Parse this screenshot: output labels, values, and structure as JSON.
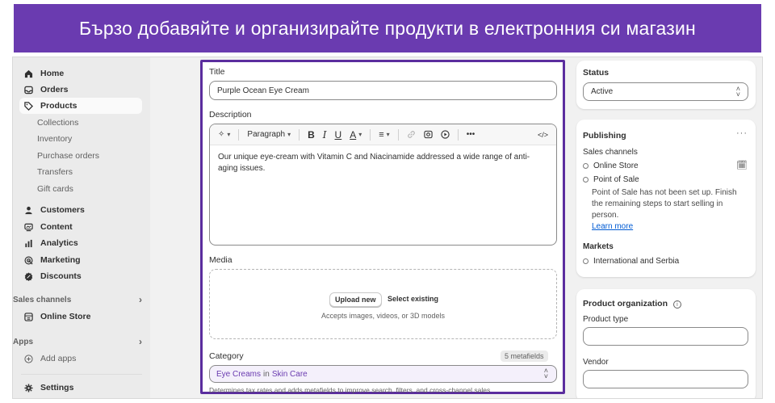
{
  "banner": {
    "text": "Бързо добавяйте и организирайте продукти в електронния си магазин"
  },
  "sidebar": {
    "items": [
      {
        "label": "Home",
        "icon": "home-icon"
      },
      {
        "label": "Orders",
        "icon": "inbox-icon"
      },
      {
        "label": "Products",
        "icon": "tag-icon"
      }
    ],
    "products_sub": [
      "Collections",
      "Inventory",
      "Purchase orders",
      "Transfers",
      "Gift cards"
    ],
    "items2": [
      {
        "label": "Customers",
        "icon": "person-icon"
      },
      {
        "label": "Content",
        "icon": "content-icon"
      },
      {
        "label": "Analytics",
        "icon": "bar-chart-icon"
      },
      {
        "label": "Marketing",
        "icon": "target-icon"
      },
      {
        "label": "Discounts",
        "icon": "discount-icon"
      }
    ],
    "sales_channels_label": "Sales channels",
    "online_store": "Online Store",
    "apps_label": "Apps",
    "add_apps": "Add apps",
    "settings": "Settings"
  },
  "product": {
    "title_label": "Title",
    "title_value": "Purple Ocean Eye Cream",
    "description_label": "Description",
    "toolbar_paragraph": "Paragraph",
    "description_text": "Our unique eye-cream with Vitamin C and Niacinamide addressed a wide range of anti-aging issues.",
    "media_label": "Media",
    "upload_new": "Upload new",
    "select_existing": "Select existing",
    "media_hint": "Accepts images, videos, or 3D models",
    "category_label": "Category",
    "metafields": "5 metafields",
    "category_name": "Eye Creams",
    "category_in": "in",
    "category_parent": "Skin Care",
    "category_help": "Determines tax rates and adds metafields to improve search, filters, and cross-channel sales"
  },
  "status": {
    "label": "Status",
    "value": "Active"
  },
  "publishing": {
    "title": "Publishing",
    "sales_channels": "Sales channels",
    "online_store": "Online Store",
    "pos": "Point of Sale",
    "pos_note": "Point of Sale has not been set up. Finish the remaining steps to start selling in person.",
    "learn_more": "Learn more",
    "markets": "Markets",
    "market_value": "International and Serbia"
  },
  "organization": {
    "title": "Product organization",
    "type_label": "Product type",
    "vendor_label": "Vendor"
  },
  "colors": {
    "banner": "#6a3bb0",
    "highlight": "#5b2d9e",
    "link": "#005bd3"
  }
}
